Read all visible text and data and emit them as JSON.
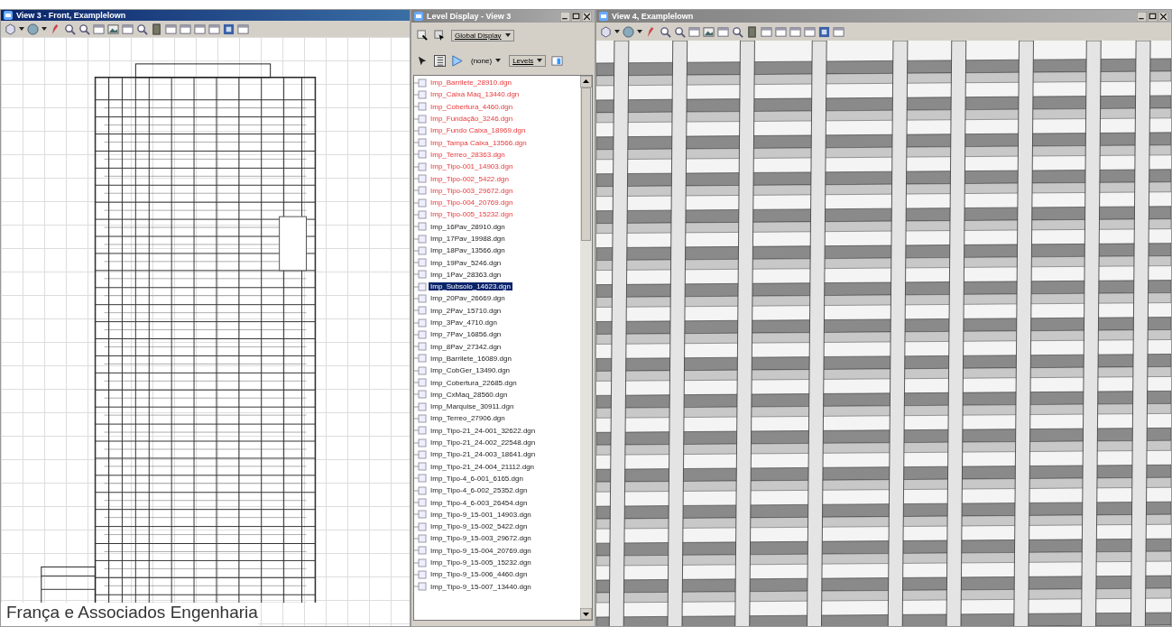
{
  "front_view": {
    "title": "View 3 - Front, Examplelown",
    "active": true,
    "caption": "França e Associados Engenharia"
  },
  "level_display": {
    "title": "Level Display - View 3",
    "active": false,
    "view_dropdown": "Global Display",
    "filter_dropdown": "(none)",
    "type_dropdown": "Levels",
    "files": [
      {
        "name": "Imp_Barrilete_28910.dgn",
        "flagged": true,
        "selected": false
      },
      {
        "name": "Imp_Caixa Maq_13440.dgn",
        "flagged": true,
        "selected": false
      },
      {
        "name": "Imp_Cobertura_4460.dgn",
        "flagged": true,
        "selected": false
      },
      {
        "name": "Imp_Fundação_3246.dgn",
        "flagged": true,
        "selected": false
      },
      {
        "name": "Imp_Fundo Caixa_18969.dgn",
        "flagged": true,
        "selected": false
      },
      {
        "name": "Imp_Tampa Caixa_13566.dgn",
        "flagged": true,
        "selected": false
      },
      {
        "name": "Imp_Terreo_28363.dgn",
        "flagged": true,
        "selected": false
      },
      {
        "name": "Imp_Tipo-001_14903.dgn",
        "flagged": true,
        "selected": false
      },
      {
        "name": "Imp_Tipo-002_5422.dgn",
        "flagged": true,
        "selected": false
      },
      {
        "name": "Imp_Tipo-003_29672.dgn",
        "flagged": true,
        "selected": false
      },
      {
        "name": "Imp_Tipo-004_20769.dgn",
        "flagged": true,
        "selected": false
      },
      {
        "name": "Imp_Tipo-005_15232.dgn",
        "flagged": true,
        "selected": false
      },
      {
        "name": "Imp_16Pav_28910.dgn",
        "flagged": false,
        "selected": false
      },
      {
        "name": "Imp_17Pav_19988.dgn",
        "flagged": false,
        "selected": false
      },
      {
        "name": "Imp_18Pav_13566.dgn",
        "flagged": false,
        "selected": false
      },
      {
        "name": "Imp_19Pav_5246.dgn",
        "flagged": false,
        "selected": false
      },
      {
        "name": "Imp_1Pav_28363.dgn",
        "flagged": false,
        "selected": false
      },
      {
        "name": "Imp_Subsolo_14623.dgn",
        "flagged": false,
        "selected": true
      },
      {
        "name": "Imp_20Pav_26669.dgn",
        "flagged": false,
        "selected": false
      },
      {
        "name": "Imp_2Pav_15710.dgn",
        "flagged": false,
        "selected": false
      },
      {
        "name": "Imp_3Pav_4710.dgn",
        "flagged": false,
        "selected": false
      },
      {
        "name": "Imp_7Pav_16856.dgn",
        "flagged": false,
        "selected": false
      },
      {
        "name": "Imp_8Pav_27342.dgn",
        "flagged": false,
        "selected": false
      },
      {
        "name": "Imp_Barrilete_16089.dgn",
        "flagged": false,
        "selected": false
      },
      {
        "name": "Imp_CobGer_13490.dgn",
        "flagged": false,
        "selected": false
      },
      {
        "name": "Imp_Cobertura_22685.dgn",
        "flagged": false,
        "selected": false
      },
      {
        "name": "Imp_CxMaq_28560.dgn",
        "flagged": false,
        "selected": false
      },
      {
        "name": "Imp_Marquise_30911.dgn",
        "flagged": false,
        "selected": false
      },
      {
        "name": "Imp_Terreo_27906.dgn",
        "flagged": false,
        "selected": false
      },
      {
        "name": "Imp_Tipo-21_24-001_32622.dgn",
        "flagged": false,
        "selected": false
      },
      {
        "name": "Imp_Tipo-21_24-002_22548.dgn",
        "flagged": false,
        "selected": false
      },
      {
        "name": "Imp_Tipo-21_24-003_18641.dgn",
        "flagged": false,
        "selected": false
      },
      {
        "name": "Imp_Tipo-21_24-004_21112.dgn",
        "flagged": false,
        "selected": false
      },
      {
        "name": "Imp_Tipo-4_6-001_6165.dgn",
        "flagged": false,
        "selected": false
      },
      {
        "name": "Imp_Tipo-4_6-002_25352.dgn",
        "flagged": false,
        "selected": false
      },
      {
        "name": "Imp_Tipo-4_6-003_26454.dgn",
        "flagged": false,
        "selected": false
      },
      {
        "name": "Imp_Tipo-9_15-001_14903.dgn",
        "flagged": false,
        "selected": false
      },
      {
        "name": "Imp_Tipo-9_15-002_5422.dgn",
        "flagged": false,
        "selected": false
      },
      {
        "name": "Imp_Tipo-9_15-003_29672.dgn",
        "flagged": false,
        "selected": false
      },
      {
        "name": "Imp_Tipo-9_15-004_20769.dgn",
        "flagged": false,
        "selected": false
      },
      {
        "name": "Imp_Tipo-9_15-005_15232.dgn",
        "flagged": false,
        "selected": false
      },
      {
        "name": "Imp_Tipo-9_15-006_4460.dgn",
        "flagged": false,
        "selected": false
      },
      {
        "name": "Imp_Tipo-9_15-007_13440.dgn",
        "flagged": false,
        "selected": false
      }
    ]
  },
  "iso_view": {
    "title": "View 4, Examplelown",
    "active": false
  }
}
